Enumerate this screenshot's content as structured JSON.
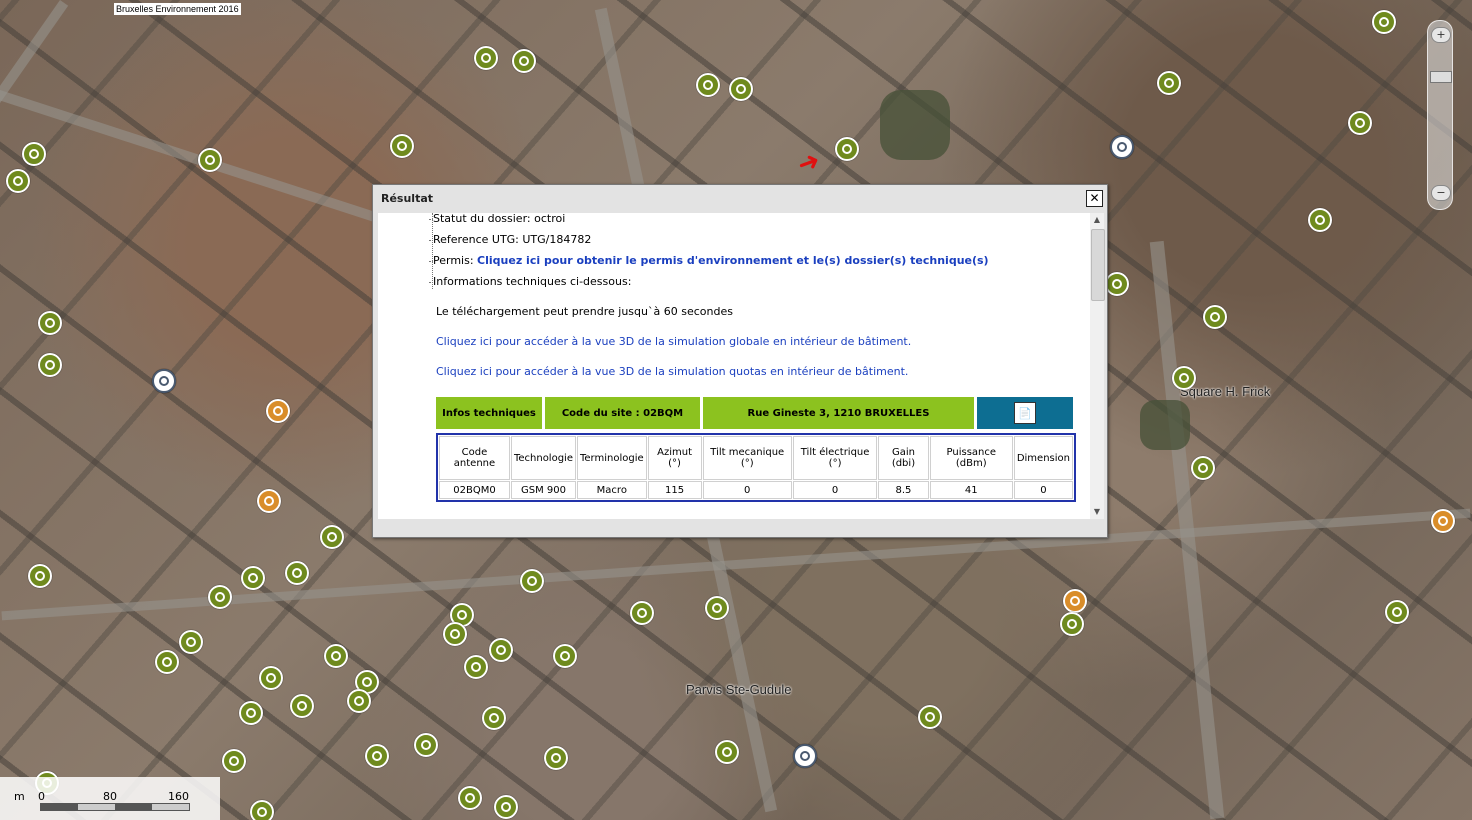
{
  "map": {
    "credit": "Bruxelles Environnement 2016",
    "labels": {
      "square": "Square H. Frick",
      "parvis": "Parvis Ste-Gudule"
    },
    "scale": {
      "unit": "m",
      "ticks": [
        "0",
        "80",
        "160"
      ]
    },
    "zoom": {
      "plus": "+",
      "minus": "−"
    },
    "arrow": "➜",
    "marker_colors": {
      "antenna": "#6f8a1e",
      "orange": "#d98d2a",
      "white": "#ffffff"
    }
  },
  "dialog": {
    "title": "Résultat",
    "close": "✕",
    "status_label": "Statut du dossier: octroi",
    "reference_label": "Reference UTG: UTG/184782",
    "permit_label": "Permis: ",
    "permit_link": "Cliquez ici pour obtenir le permis d'environnement et le(s) dossier(s) technique(s)",
    "tech_info_label": "Informations techniques ci-dessous:",
    "download_note": "Le téléchargement peut prendre jusqu`à 60 secondes",
    "link_3d_global": "Cliquez ici pour accéder à la vue 3D de la simulation globale en intérieur de bâtiment.",
    "link_3d_quota": "Cliquez ici pour accéder à la vue 3D de la simulation quotas en intérieur de bâtiment.",
    "info_bar": {
      "tech": "Infos techniques",
      "site": "Code du site : 02BQM",
      "address": "Rue Gineste 3, 1210 BRUXELLES",
      "doc_icon": "📄"
    },
    "table": {
      "headers": [
        "Code antenne",
        "Technologie",
        "Terminologie",
        "Azimut (°)",
        "Tilt mecanique (°)",
        "Tilt électrique (°)",
        "Gain (dbi)",
        "Puissance (dBm)",
        "Dimension"
      ],
      "rows": [
        [
          "02BQM0",
          "GSM 900",
          "Macro",
          "115",
          "0",
          "0",
          "8.5",
          "41",
          "0"
        ]
      ]
    },
    "scroll": {
      "up": "▲",
      "down": "▼"
    },
    "colors": {
      "accent_green": "#8cc21f",
      "accent_teal": "#0d6e92",
      "link_blue": "#1a3fbf",
      "table_border": "#2233aa"
    }
  }
}
